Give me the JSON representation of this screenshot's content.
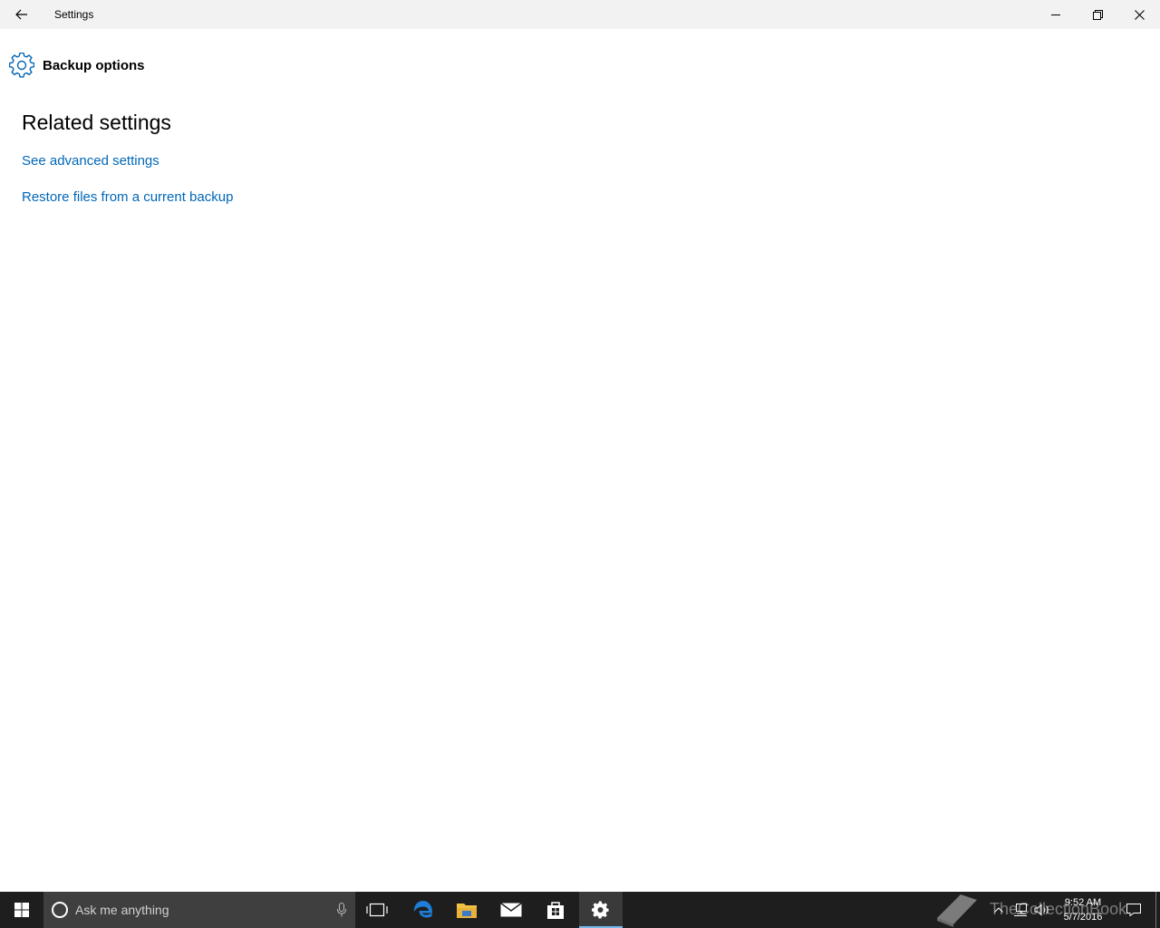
{
  "window": {
    "title": "Settings",
    "icons": {
      "back": "back-arrow-icon",
      "minimize": "minimize-icon",
      "maximize": "restore-icon",
      "close": "close-icon"
    }
  },
  "page": {
    "header_icon": "gear-icon",
    "title": "Backup options",
    "section_title": "Related settings",
    "links": [
      "See advanced settings",
      "Restore files from a current backup"
    ],
    "link_color": "#0067b8"
  },
  "taskbar": {
    "search_placeholder": "Ask me anything",
    "apps": [
      "task-view",
      "edge",
      "file-explorer",
      "mail",
      "store",
      "settings"
    ],
    "active_app": "settings",
    "watermark": "TheCollectionBook",
    "clock": {
      "time": "9:52 AM",
      "date": "5/7/2016"
    }
  }
}
